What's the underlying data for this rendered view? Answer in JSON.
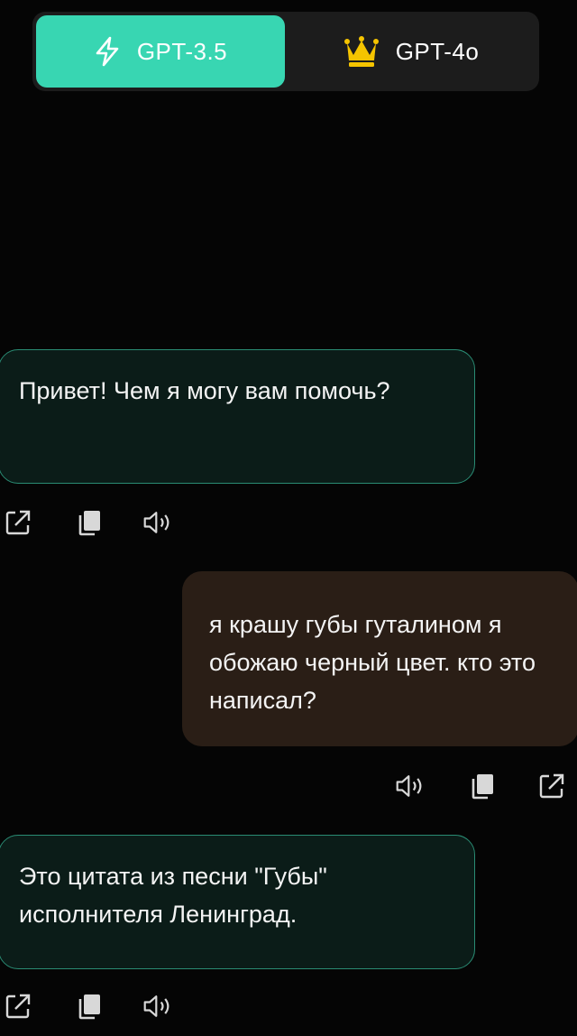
{
  "model_switch": {
    "gpt35_label": "GPT-3.5",
    "gpt4o_label": "GPT-4o",
    "active": "gpt35",
    "accent_color": "#38d6b2",
    "crown_color": "#f5c400"
  },
  "messages": [
    {
      "role": "bot",
      "text": "Привет! Чем я могу вам помочь?",
      "actions": [
        "share-icon",
        "copy-icon",
        "speaker-icon"
      ]
    },
    {
      "role": "user",
      "text": "я крашу губы гуталином я обожаю черный цвет. кто это написал?",
      "actions": [
        "speaker-icon",
        "copy-icon",
        "share-icon"
      ]
    },
    {
      "role": "bot",
      "text": "Это цитата из песни \"Губы\" исполнителя Ленинград.",
      "actions": [
        "share-icon",
        "copy-icon",
        "speaker-icon"
      ]
    }
  ]
}
